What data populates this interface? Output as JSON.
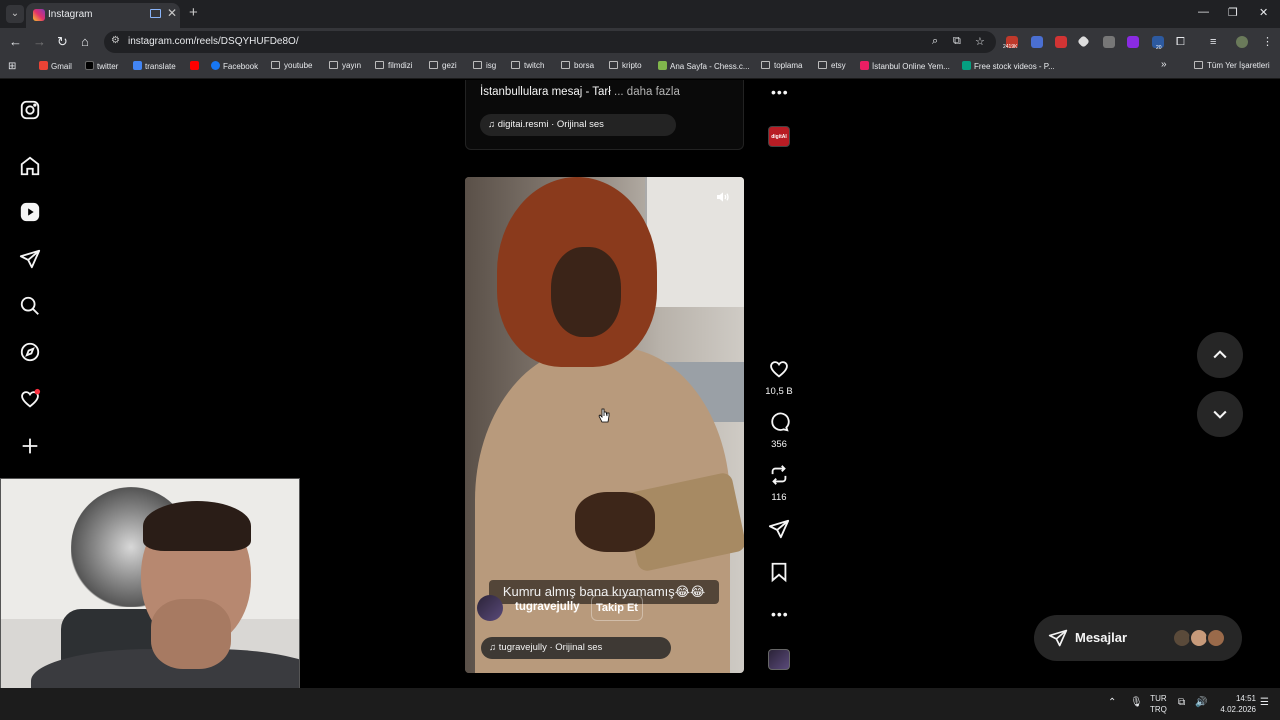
{
  "browser": {
    "tab_title": "Instagram",
    "url": "instagram.com/reels/DSQYHUFDe8O/",
    "ext_badge_1": "2419K",
    "ext_badge_2": "20",
    "bookmarks": [
      {
        "label": "Gmail",
        "icon": "gmail-icon"
      },
      {
        "label": "twitter",
        "icon": "x-icon"
      },
      {
        "label": "translate",
        "icon": "translate-icon"
      },
      {
        "label": "",
        "icon": "youtube-icon"
      },
      {
        "label": "Facebook",
        "icon": "facebook-icon"
      },
      {
        "label": "youtube",
        "icon": "folder-icon"
      },
      {
        "label": "yayın",
        "icon": "folder-icon"
      },
      {
        "label": "filmdizi",
        "icon": "folder-icon"
      },
      {
        "label": "gezi",
        "icon": "folder-icon"
      },
      {
        "label": "isg",
        "icon": "folder-icon"
      },
      {
        "label": "twitch",
        "icon": "folder-icon"
      },
      {
        "label": "borsa",
        "icon": "folder-icon"
      },
      {
        "label": "kripto",
        "icon": "folder-icon"
      },
      {
        "label": "Ana Sayfa - Chess.c...",
        "icon": "chess-icon"
      },
      {
        "label": "toplama",
        "icon": "folder-icon"
      },
      {
        "label": "etsy",
        "icon": "folder-icon"
      },
      {
        "label": "İstanbul Online Yem...",
        "icon": "yemeksepeti-icon"
      },
      {
        "label": "Free stock videos - P...",
        "icon": "pexels-icon"
      }
    ],
    "all_bookmarks": "Tüm Yer İşaretleri"
  },
  "sidebar": {
    "items": [
      "instagram-logo-icon",
      "home-icon",
      "reels-icon",
      "direct-icon",
      "search-icon",
      "explore-icon",
      "notifications-icon",
      "create-icon"
    ]
  },
  "previous_reel": {
    "caption": "İstanbullulara mesaj - Tarł",
    "more": "... daha fazla",
    "audio": "digitai.resmi · Orijinal ses",
    "avatar_text": "digitAI"
  },
  "current_reel": {
    "subtitle": "Kumru almış bana kıyamamış😂😂",
    "author": "tugravejully",
    "follow": "Takip Et",
    "audio": "tugravejully · Orijinal ses"
  },
  "actions": {
    "likes": "10,5 B",
    "comments": "356",
    "reposts": "116"
  },
  "messages": {
    "label": "Mesajlar"
  },
  "taskbar": {
    "lang_1": "TUR",
    "lang_2": "TRQ",
    "time": "14:51",
    "date": "4.02.2026"
  },
  "colors": {
    "background": "#000000",
    "accent_notification": "#ff3040",
    "panel": "#262626"
  }
}
